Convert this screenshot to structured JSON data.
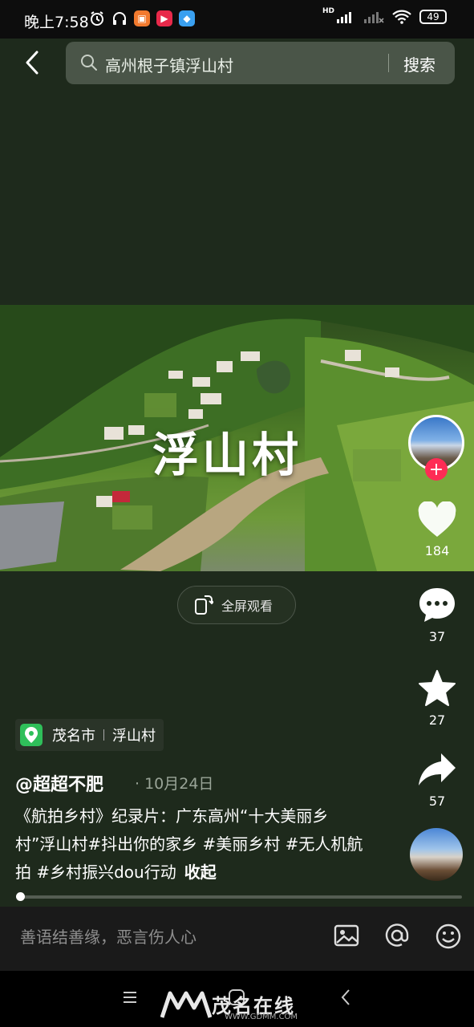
{
  "status_bar": {
    "time": "晚上7:58",
    "network_badge": "HD",
    "battery": "49"
  },
  "search": {
    "query": "高州根子镇浮山村",
    "button_label": "搜索"
  },
  "video": {
    "overlay_title": "浮山村",
    "fullscreen_label": "全屏观看"
  },
  "actions": {
    "likes": "184",
    "comments": "37",
    "favorites": "27",
    "shares": "57"
  },
  "location": {
    "city": "茂名市",
    "place": "浮山村"
  },
  "post": {
    "author": "@超超不肥",
    "date": "· 10月24日",
    "description": "《航拍乡村》纪录片：广东高州“十大美丽乡村”浮山村#抖出你的家乡 #美丽乡村 #无人机航拍 #乡村振兴dou行动",
    "fold_label": "收起",
    "progress": 0.01
  },
  "comment": {
    "placeholder": "善语结善缘，恶言伤人心"
  },
  "watermark": {
    "text": "茂名在线",
    "url": "WWW.GDMM.COM"
  },
  "colors": {
    "background": "#1e2a1c",
    "accent_red": "#fe2c55",
    "location_green": "#2fbf5a"
  }
}
